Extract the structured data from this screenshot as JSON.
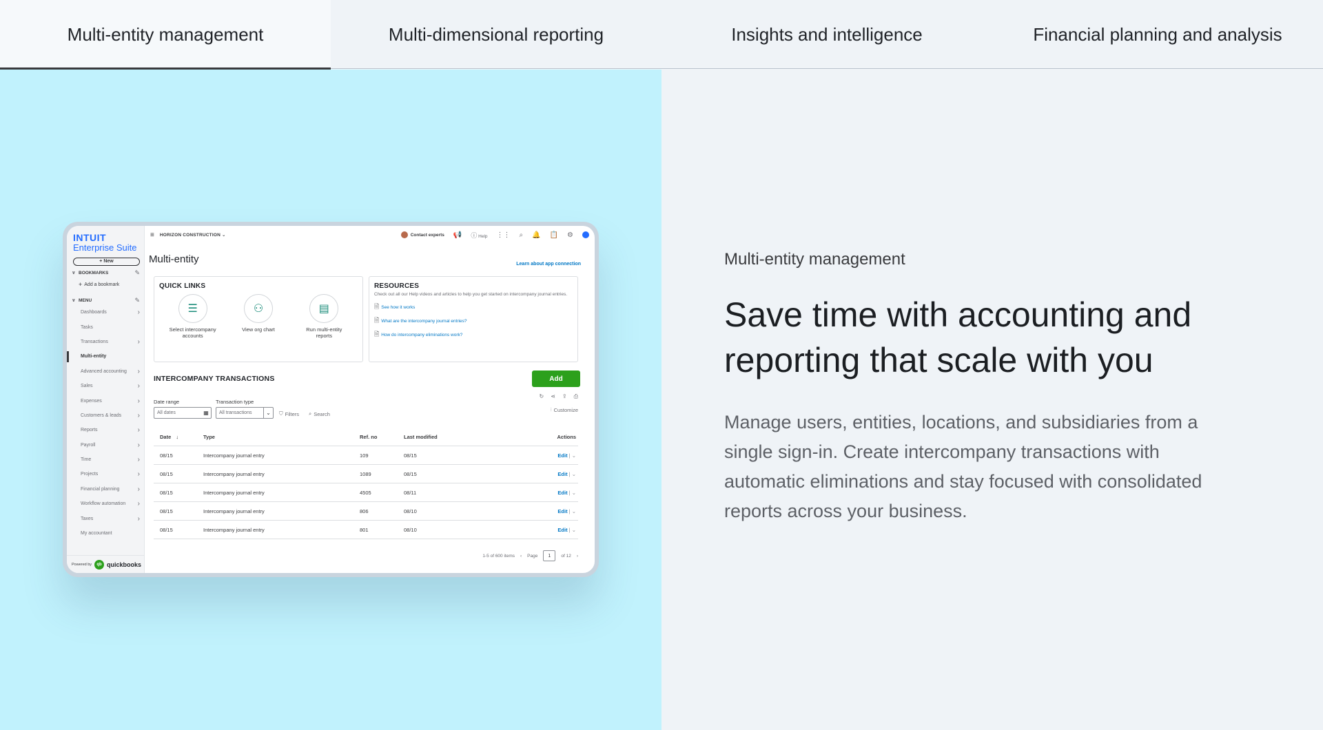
{
  "tabs": [
    {
      "label": "Multi-entity management",
      "active": true
    },
    {
      "label": "Multi-dimensional reporting",
      "active": false
    },
    {
      "label": "Insights and intelligence",
      "active": false
    },
    {
      "label": "Financial planning and analysis",
      "active": false
    }
  ],
  "feature": {
    "eyebrow": "Multi-entity management",
    "headline": "Save time with accounting and reporting that scale with you",
    "body": "Manage users, entities, locations, and subsidiaries from a single sign-in. Create intercompany transactions with automatic eliminations and stay focused with consolidated reports across your business."
  },
  "app": {
    "logo_top": "INTUIT",
    "logo_bottom": "Enterprise Suite",
    "new_label": "+ New",
    "bookmarks_label": "BOOKMARKS",
    "add_bookmark": "Add a bookmark",
    "menu_label": "MENU",
    "menu_items": [
      {
        "label": "Dashboards",
        "chevron": true
      },
      {
        "label": "Tasks",
        "chevron": false
      },
      {
        "label": "Transactions",
        "chevron": true
      },
      {
        "label": "Multi-entity",
        "chevron": false,
        "active": true
      },
      {
        "label": "Advanced accounting",
        "chevron": true
      },
      {
        "label": "Sales",
        "chevron": true
      },
      {
        "label": "Expenses",
        "chevron": true
      },
      {
        "label": "Customers & leads",
        "chevron": true
      },
      {
        "label": "Reports",
        "chevron": true
      },
      {
        "label": "Payroll",
        "chevron": true
      },
      {
        "label": "Time",
        "chevron": true
      },
      {
        "label": "Projects",
        "chevron": true
      },
      {
        "label": "Financial planning",
        "chevron": true
      },
      {
        "label": "Workflow automation",
        "chevron": true
      },
      {
        "label": "Taxes",
        "chevron": true
      },
      {
        "label": "My accountant",
        "chevron": false
      }
    ],
    "powered_by": "Powered by",
    "qb_mark": "qb",
    "qb_word": "quickbooks",
    "company": "HORIZON CONSTRUCTION",
    "contact": "Contact experts",
    "help": "Help",
    "page_title": "Multi-entity",
    "learn_link": "Learn about app connection",
    "quick_links": {
      "title": "QUICK LINKS",
      "items": [
        {
          "label": "Select intercompany accounts",
          "icon": "list-icon"
        },
        {
          "label": "View org chart",
          "icon": "org-chart-icon"
        },
        {
          "label": "Run multi-entity reports",
          "icon": "report-icon"
        }
      ]
    },
    "resources": {
      "title": "RESOURCES",
      "description": "Check out all our Help videos and articles to help you get started on intercompany journal entries.",
      "links": [
        "See how it works",
        "What are the intercompany journal entries?",
        "How do intercompany eliminations work?"
      ]
    },
    "transactions": {
      "title": "INTERCOMPANY TRANSACTIONS",
      "add_label": "Add",
      "date_range_label": "Date range",
      "date_range_value": "All dates",
      "type_label": "Transaction type",
      "type_value": "All transactions",
      "filters_label": "Filters",
      "search_label": "Search",
      "customize_label": "Customize",
      "columns": {
        "date": "Date",
        "sort": "↓",
        "type": "Type",
        "ref": "Ref. no",
        "modified": "Last modified",
        "actions": "Actions"
      },
      "rows": [
        {
          "date": "08/15",
          "type": "Intercompany journal entry",
          "ref": "109",
          "modified": "08/15",
          "action": "Edit"
        },
        {
          "date": "08/15",
          "type": "Intercompany journal entry",
          "ref": "1089",
          "modified": "08/15",
          "action": "Edit"
        },
        {
          "date": "08/15",
          "type": "Intercompany journal entry",
          "ref": "4505",
          "modified": "08/11",
          "action": "Edit"
        },
        {
          "date": "08/15",
          "type": "Intercompany journal entry",
          "ref": "806",
          "modified": "08/10",
          "action": "Edit"
        },
        {
          "date": "08/15",
          "type": "Intercompany journal entry",
          "ref": "801",
          "modified": "08/10",
          "action": "Edit"
        }
      ],
      "pager_items": "1-5 of 600 items",
      "pager_page_label": "Page",
      "pager_page": "1",
      "pager_of": "of 12"
    }
  },
  "colors": {
    "accent_blue": "#236cff",
    "link_blue": "#0077c5",
    "add_green": "#2ca01c",
    "left_panel": "#c1f2fd"
  }
}
